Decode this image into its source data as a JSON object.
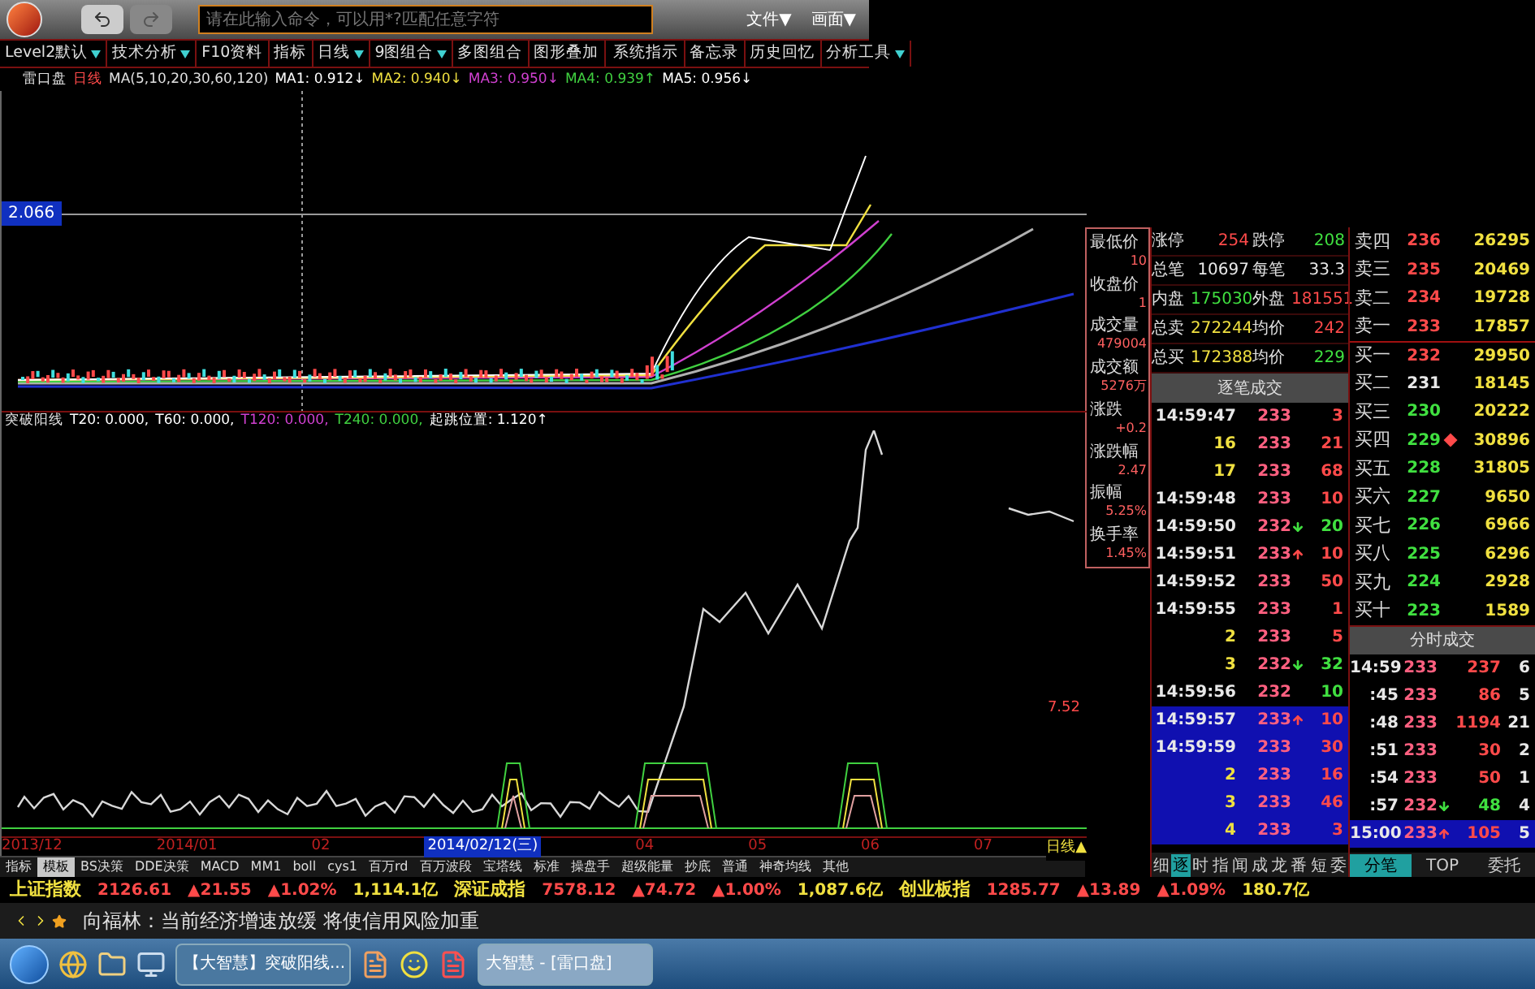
{
  "title_bar": {
    "command_placeholder": "请在此输入命令，可以用*?匹配任意字符",
    "menus": [
      "文件▼",
      "画面▼"
    ]
  },
  "toolbar": [
    {
      "label": "Level2默认",
      "dropdown": true
    },
    {
      "label": "技术分析",
      "dropdown": true
    },
    {
      "label": "F10资料",
      "dropdown": false
    },
    {
      "label": "指标",
      "dropdown": false
    },
    {
      "label": "日线",
      "dropdown": true
    },
    {
      "label": "9图组合",
      "dropdown": true
    },
    {
      "label": "多图组合",
      "dropdown": false
    },
    {
      "label": "图形叠加",
      "dropdown": false
    },
    {
      "label": "系统指示",
      "dropdown": false
    },
    {
      "label": "备忘录",
      "dropdown": false
    },
    {
      "label": "历史回忆",
      "dropdown": false
    },
    {
      "label": "分析工具",
      "dropdown": true
    }
  ],
  "chart": {
    "name": "雷口盘",
    "period": "日线",
    "ma_params": "MA(5,10,20,30,60,120)",
    "ma_values": [
      {
        "label": "MA1:",
        "value": "0.912↓",
        "color": "#ffffff"
      },
      {
        "label": "MA2:",
        "value": "0.940↓",
        "color": "#f0e040"
      },
      {
        "label": "MA3:",
        "value": "0.950↓",
        "color": "#d040d0"
      },
      {
        "label": "MA4:",
        "value": "0.939↑",
        "color": "#40d040"
      },
      {
        "label": "MA5:",
        "value": "0.956↓",
        "color": "#ffffff"
      }
    ],
    "crosshair_price": "2.066",
    "lower_name": "突破阳线",
    "lower_values": [
      {
        "label": "T20:",
        "value": "0.000,",
        "color": "#ffffff"
      },
      {
        "label": "T60:",
        "value": "0.000,",
        "color": "#ffffff"
      },
      {
        "label": "T120:",
        "value": "0.000,",
        "color": "#d040d0"
      },
      {
        "label": "T240:",
        "value": "0.000,",
        "color": "#40d040"
      },
      {
        "label": "起跳位置:",
        "value": "1.120↑",
        "color": "#ffffff"
      }
    ],
    "lower_axis_label": "7.52",
    "dates": [
      {
        "label": "2013/12",
        "selected": false
      },
      {
        "label": "2014/01",
        "selected": false
      },
      {
        "label": "02",
        "selected": false
      },
      {
        "label": "2014/02/12(三)",
        "selected": true
      },
      {
        "label": "04",
        "selected": false
      },
      {
        "label": "05",
        "selected": false
      },
      {
        "label": "06",
        "selected": false
      },
      {
        "label": "07",
        "selected": false
      }
    ],
    "period_button": "日线▲"
  },
  "indicator_tabs": [
    {
      "label": "指标",
      "selected": false
    },
    {
      "label": "模板",
      "selected": true
    },
    {
      "label": "BS决策",
      "selected": false
    },
    {
      "label": "DDE决策",
      "selected": false
    },
    {
      "label": "MACD",
      "selected": false
    },
    {
      "label": "MM1",
      "selected": false
    },
    {
      "label": "boll",
      "selected": false
    },
    {
      "label": "cys1",
      "selected": false
    },
    {
      "label": "百万rd",
      "selected": false
    },
    {
      "label": "百万波段",
      "selected": false
    },
    {
      "label": "宝塔线",
      "selected": false
    },
    {
      "label": "标准",
      "selected": false
    },
    {
      "label": "操盘手",
      "selected": false
    },
    {
      "label": "超级能量",
      "selected": false
    },
    {
      "label": "抄底",
      "selected": false
    },
    {
      "label": "普通",
      "selected": false
    },
    {
      "label": "神奇均线",
      "selected": false
    },
    {
      "label": "其他",
      "selected": false
    }
  ],
  "quote_stats": [
    {
      "label": "最低价",
      "value": "10"
    },
    {
      "label": "收盘价",
      "value": "1"
    },
    {
      "label": "成交量",
      "value": "479004"
    },
    {
      "label": "成交额",
      "value": "5276万"
    },
    {
      "label": "涨跌",
      "value": "+0.2"
    },
    {
      "label": "涨跌幅",
      "value": "2.47"
    },
    {
      "label": "振幅",
      "value": "5.25%"
    },
    {
      "label": "换手率",
      "value": "1.45%"
    }
  ],
  "summary": [
    {
      "cells": [
        {
          "label": "涨停",
          "value": "254",
          "color": "#ff4a4a"
        },
        {
          "label": "跌停",
          "value": "208",
          "color": "#40e040"
        }
      ]
    },
    {
      "cells": [
        {
          "label": "总笔",
          "value": "10697",
          "color": "#e8e8e8"
        },
        {
          "label": "每笔",
          "value": "33.3",
          "color": "#e8e8e8"
        }
      ]
    },
    {
      "cells": [
        {
          "label": "内盘",
          "value": "175030",
          "color": "#40e040"
        },
        {
          "label": "外盘",
          "value": "181551",
          "color": "#ff4a4a"
        }
      ]
    },
    {
      "cells": [
        {
          "label": "总卖",
          "value": "272244",
          "color": "#f0e040"
        },
        {
          "label": "均价",
          "value": "242",
          "color": "#ff4a4a"
        }
      ]
    },
    {
      "cells": [
        {
          "label": "总买",
          "value": "172388",
          "color": "#f0e040"
        },
        {
          "label": "均价",
          "value": "229",
          "color": "#40e040"
        }
      ]
    }
  ],
  "ticks_title": "逐笔成交",
  "ticks": [
    {
      "time": "14:59:47",
      "price": "233",
      "up": false,
      "down": false,
      "volume": "3",
      "color": "#ff4a4a",
      "selected": false
    },
    {
      "time": "16",
      "price": "233",
      "up": false,
      "down": false,
      "volume": "21",
      "color": "#ff4a4a",
      "selected": false
    },
    {
      "time": "17",
      "price": "233",
      "up": false,
      "down": false,
      "volume": "68",
      "color": "#ff4a4a",
      "selected": false
    },
    {
      "time": "14:59:48",
      "price": "233",
      "up": false,
      "down": false,
      "volume": "10",
      "color": "#ff4a4a",
      "selected": false
    },
    {
      "time": "14:59:50",
      "price": "232",
      "up": false,
      "down": true,
      "volume": "20",
      "color": "#40e040",
      "selected": false
    },
    {
      "time": "14:59:51",
      "price": "233",
      "up": true,
      "down": false,
      "volume": "10",
      "color": "#ff4a4a",
      "selected": false
    },
    {
      "time": "14:59:52",
      "price": "233",
      "up": false,
      "down": false,
      "volume": "50",
      "color": "#ff4a4a",
      "selected": false
    },
    {
      "time": "14:59:55",
      "price": "233",
      "up": false,
      "down": false,
      "volume": "1",
      "color": "#ff4a4a",
      "selected": false
    },
    {
      "time": "2",
      "price": "233",
      "up": false,
      "down": false,
      "volume": "5",
      "color": "#ff4a4a",
      "selected": false
    },
    {
      "time": "3",
      "price": "232",
      "up": false,
      "down": true,
      "volume": "32",
      "color": "#40e040",
      "selected": false
    },
    {
      "time": "14:59:56",
      "price": "232",
      "up": false,
      "down": false,
      "volume": "10",
      "color": "#40e040",
      "selected": false
    },
    {
      "time": "14:59:57",
      "price": "233",
      "up": true,
      "down": false,
      "volume": "10",
      "color": "#ff4a4a",
      "selected": true
    },
    {
      "time": "14:59:59",
      "price": "233",
      "up": false,
      "down": false,
      "volume": "30",
      "color": "#ff4a4a",
      "selected": true
    },
    {
      "time": "2",
      "price": "233",
      "up": false,
      "down": false,
      "volume": "16",
      "color": "#ff4a4a",
      "selected": true
    },
    {
      "time": "3",
      "price": "233",
      "up": false,
      "down": false,
      "volume": "46",
      "color": "#ff4a4a",
      "selected": true
    },
    {
      "time": "4",
      "price": "233",
      "up": false,
      "down": false,
      "volume": "3",
      "color": "#ff4a4a",
      "selected": true
    }
  ],
  "ticks_tabs": [
    {
      "label": "细",
      "selected": false
    },
    {
      "label": "逐",
      "selected": true
    },
    {
      "label": "时",
      "selected": false
    },
    {
      "label": "指",
      "selected": false
    },
    {
      "label": "闻",
      "selected": false
    },
    {
      "label": "成",
      "selected": false
    },
    {
      "label": "龙",
      "selected": false
    },
    {
      "label": "番",
      "selected": false
    },
    {
      "label": "短",
      "selected": false
    },
    {
      "label": "委",
      "selected": false
    }
  ],
  "order_book": [
    {
      "label": "卖四",
      "price": "236",
      "color": "#ff4a4a",
      "volume": "26295",
      "marker": false
    },
    {
      "label": "卖三",
      "price": "235",
      "color": "#ff4a4a",
      "volume": "20469",
      "marker": false
    },
    {
      "label": "卖二",
      "price": "234",
      "color": "#ff4a4a",
      "volume": "19728",
      "marker": false
    },
    {
      "label": "卖一",
      "price": "233",
      "color": "#ff4a4a",
      "volume": "17857",
      "marker": false
    },
    {
      "label": "买一",
      "price": "232",
      "color": "#ff4a4a",
      "volume": "29950",
      "marker": false
    },
    {
      "label": "买二",
      "price": "231",
      "color": "#e8e8e8",
      "volume": "18145",
      "marker": false
    },
    {
      "label": "买三",
      "price": "230",
      "color": "#40e040",
      "volume": "20222",
      "marker": false
    },
    {
      "label": "买四",
      "price": "229",
      "color": "#40e040",
      "volume": "30896",
      "marker": true
    },
    {
      "label": "买五",
      "price": "228",
      "color": "#40e040",
      "volume": "31805",
      "marker": false
    },
    {
      "label": "买六",
      "price": "227",
      "color": "#40e040",
      "volume": "9650",
      "marker": false
    },
    {
      "label": "买七",
      "price": "226",
      "color": "#40e040",
      "volume": "6966",
      "marker": false
    },
    {
      "label": "买八",
      "price": "225",
      "color": "#40e040",
      "volume": "6296",
      "marker": false
    },
    {
      "label": "买九",
      "price": "224",
      "color": "#40e040",
      "volume": "2928",
      "marker": false
    },
    {
      "label": "买十",
      "price": "223",
      "color": "#40e040",
      "volume": "1589",
      "marker": false
    }
  ],
  "minute_title": "分时成交",
  "minute_trades": [
    {
      "time": "14:59",
      "price": "233",
      "up": false,
      "down": false,
      "volume": "237",
      "count": "6",
      "color": "#ff4a4a",
      "selected": false
    },
    {
      "time": ":45",
      "price": "233",
      "up": false,
      "down": false,
      "volume": "86",
      "count": "5",
      "color": "#ff4a4a",
      "selected": false
    },
    {
      "time": ":48",
      "price": "233",
      "up": false,
      "down": false,
      "volume": "1194",
      "count": "21",
      "color": "#ff4a4a",
      "selected": false
    },
    {
      "time": ":51",
      "price": "233",
      "up": false,
      "down": false,
      "volume": "30",
      "count": "2",
      "color": "#ff4a4a",
      "selected": false
    },
    {
      "time": ":54",
      "price": "233",
      "up": false,
      "down": false,
      "volume": "50",
      "count": "1",
      "color": "#ff4a4a",
      "selected": false
    },
    {
      "time": ":57",
      "price": "232",
      "up": false,
      "down": true,
      "volume": "48",
      "count": "4",
      "color": "#40e040",
      "selected": false
    },
    {
      "time": "15:00",
      "price": "233",
      "up": true,
      "down": false,
      "volume": "105",
      "count": "5",
      "color": "#ff4a4a",
      "selected": true
    }
  ],
  "minute_tabs": [
    {
      "label": "分笔",
      "selected": true
    },
    {
      "label": "TOP",
      "selected": false
    },
    {
      "label": "委托",
      "selected": false
    }
  ],
  "index_ticker": [
    {
      "name": "上证指数",
      "value": "2126.61",
      "change": "▲21.55",
      "pct": "▲1.02%",
      "turnover": "1,114.1亿"
    },
    {
      "name": "深证成指",
      "value": "7578.12",
      "change": "▲74.72",
      "pct": "▲1.00%",
      "turnover": "1,087.6亿"
    },
    {
      "name": "创业板指",
      "value": "1285.77",
      "change": "▲13.89",
      "pct": "▲1.09%",
      "turnover": "180.7亿"
    }
  ],
  "news": {
    "headline": "向福林：当前经济增速放缓 将使信用风险加重"
  },
  "taskbar": [
    {
      "label": "【大智慧】突破阳线...",
      "selected": false
    },
    {
      "label": "大智慧 - [雷口盘]",
      "selected": true
    }
  ]
}
